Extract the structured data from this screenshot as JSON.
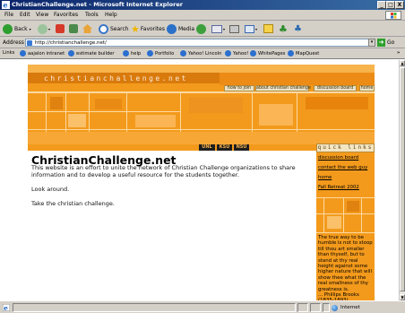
{
  "window": {
    "title": "ChristianChallenge.net - Microsoft Internet Explorer",
    "controls": [
      "_",
      "□",
      "X"
    ]
  },
  "menu": [
    "File",
    "Edit",
    "View",
    "Favorites",
    "Tools",
    "Help"
  ],
  "toolbar": {
    "back_label": "Back",
    "search_label": "Search",
    "favorites_label": "Favorites",
    "media_label": "Media"
  },
  "address": {
    "label": "Address",
    "url": "http://christianchallenge.net/",
    "go_label": "Go"
  },
  "links": {
    "label": "Links",
    "items": [
      "aajalon intranet",
      "estimate builder",
      "help",
      "Portfolio",
      "Yahoo! Lincoln",
      "Yahoo!",
      "WhitePages",
      "MapQuest"
    ]
  },
  "site": {
    "logo_text": "christianchallenge.net",
    "top_nav": [
      "how to join",
      "about christian challenge",
      "discussion board",
      "home"
    ],
    "school_nav": [
      "UNL",
      "KSU",
      "NSU"
    ],
    "heading": "ChristianChallenge.net",
    "intro": "This website is an effort to unite the network of Christian Challenge organizations to share information and to develop a useful resource for the students together.",
    "para2": "Look around.",
    "para3": "Take the christian challenge."
  },
  "sidebar": {
    "title": "quick links",
    "links": [
      "discussion board",
      "contact the web guy",
      "home",
      "Fall Retreat 2002"
    ],
    "quote": "The true way to be humble is not to stoop till thou art smaller than thyself, but to stand at thy real height against some higher nature that will show thee what the real smallness of thy greatness is.\n... Phillips Brooks (1835-1893)"
  },
  "status": {
    "zone": "Internet"
  }
}
